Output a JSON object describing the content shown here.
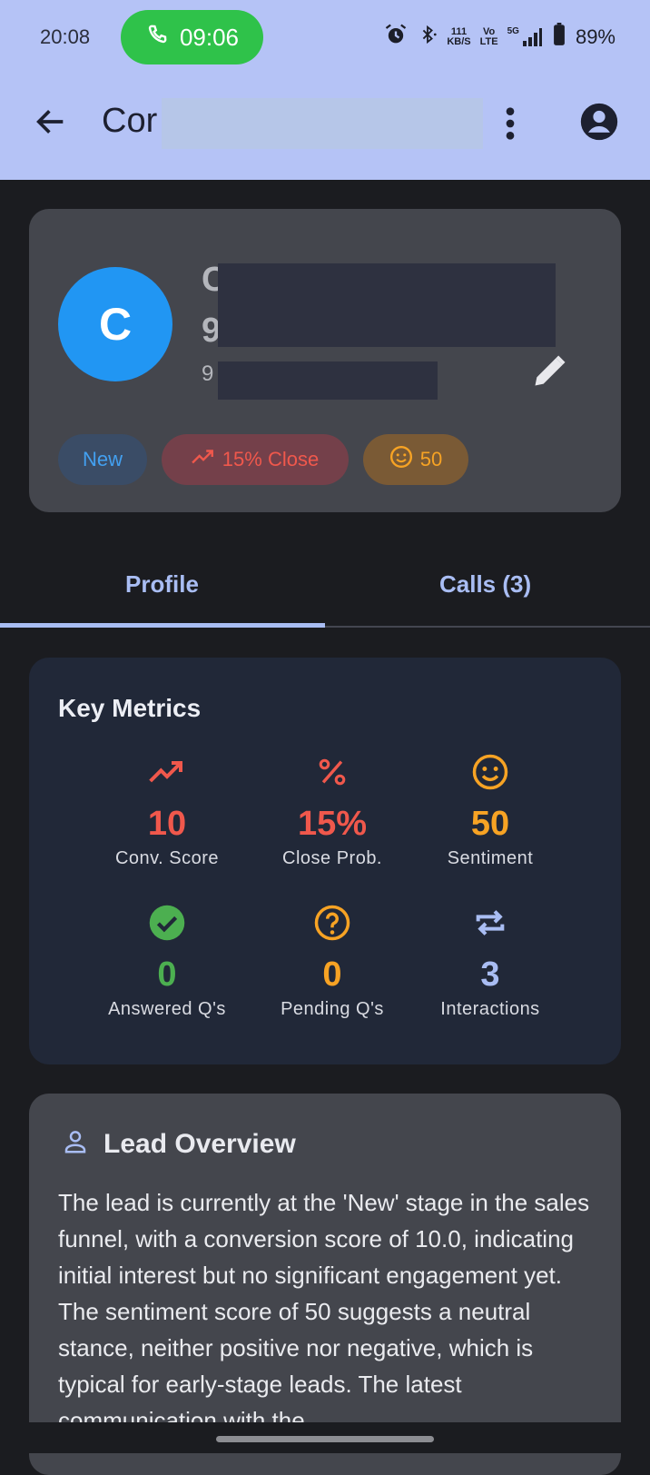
{
  "status_bar": {
    "time": "20:08",
    "call_timer": "09:06",
    "net_speed_top": "111",
    "net_speed_bottom": "KB/S",
    "volte_top": "Vo",
    "volte_bottom": "LTE",
    "network": "5G",
    "battery": "89%"
  },
  "app_bar": {
    "title": "Cor"
  },
  "profile": {
    "avatar_letter": "C",
    "name_peek": "C\n9",
    "phone_peek": "9",
    "chips": {
      "stage": "New",
      "close": "15% Close",
      "sentiment": "50"
    }
  },
  "tabs": {
    "profile": "Profile",
    "calls": "Calls (3)"
  },
  "metrics": {
    "title": "Key Metrics",
    "items": [
      {
        "value": "10",
        "label": "Conv. Score",
        "color": "#f0584c",
        "icon": "trending-up-icon"
      },
      {
        "value": "15%",
        "label": "Close Prob.",
        "color": "#f0584c",
        "icon": "percent-icon"
      },
      {
        "value": "50",
        "label": "Sentiment",
        "color": "#f7a324",
        "icon": "smiley-icon"
      },
      {
        "value": "0",
        "label": "Answered Q's",
        "color": "#4caf50",
        "icon": "check-circle-icon"
      },
      {
        "value": "0",
        "label": "Pending Q's",
        "color": "#f7a324",
        "icon": "question-circle-icon"
      },
      {
        "value": "3",
        "label": "Interactions",
        "color": "#a9bdf3",
        "icon": "repeat-icon"
      }
    ]
  },
  "overview": {
    "title": "Lead Overview",
    "text": "The lead is currently at the 'New' stage in the sales funnel, with a conversion score of 10.0, indicating initial interest but no significant engagement yet. The sentiment score of 50 suggests a neutral stance, neither positive nor negative, which is typical for early-stage leads. The latest communication with the"
  }
}
